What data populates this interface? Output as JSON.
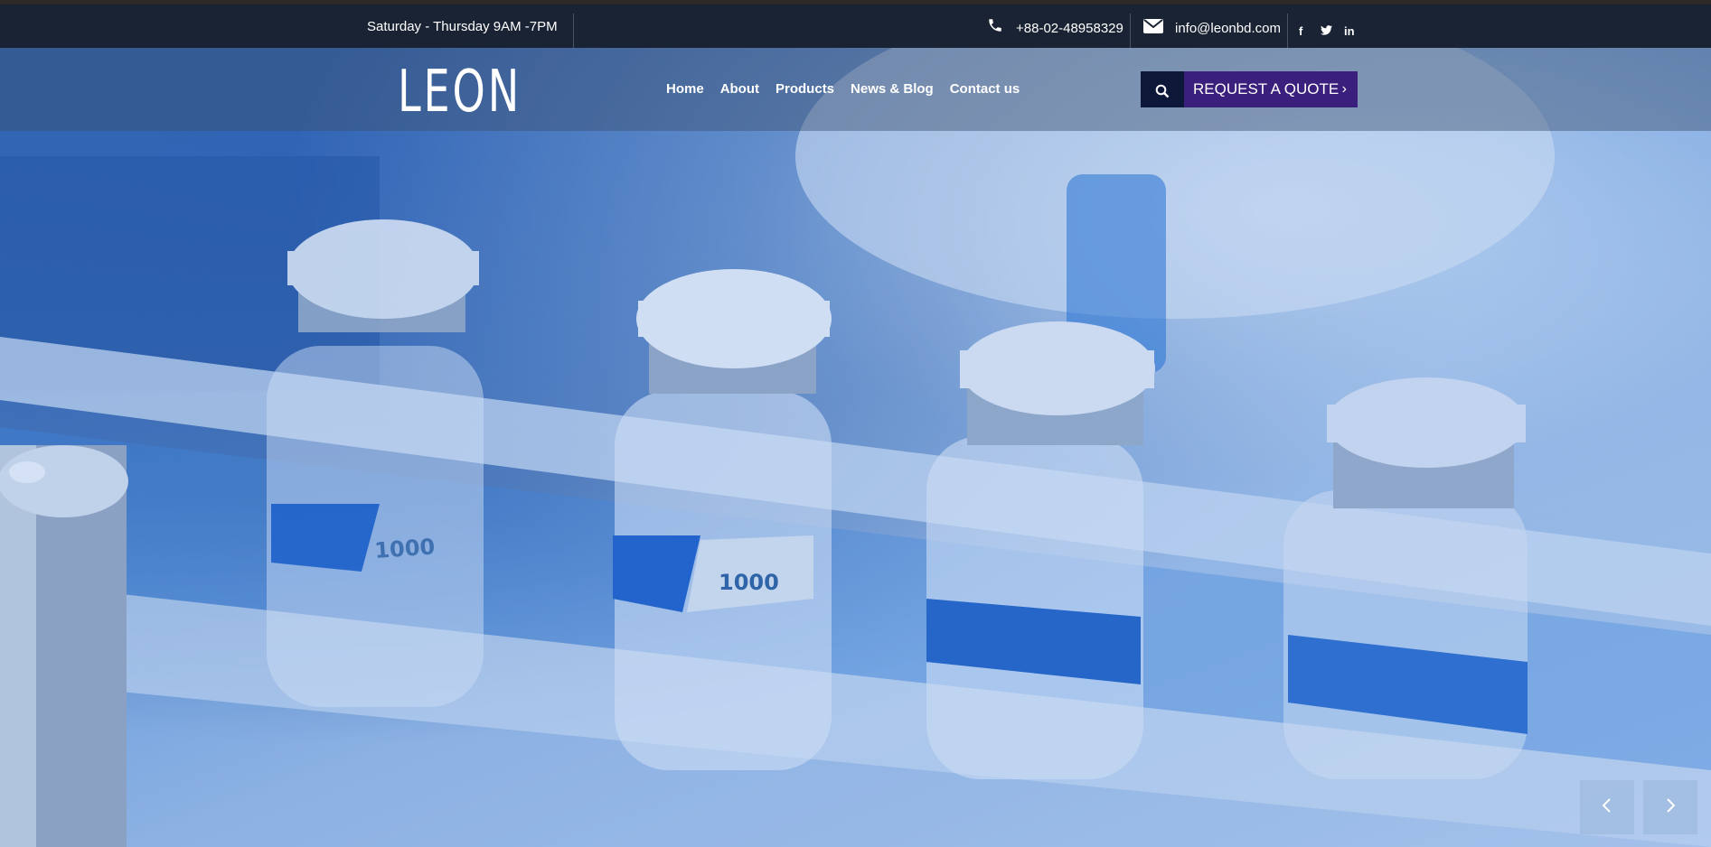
{
  "topbar": {
    "hours": "Saturday - Thursday  9AM -7PM",
    "phone": "+88-02-48958329",
    "email": "info@leonbd.com",
    "social": [
      {
        "icon": "facebook-icon",
        "glyph": "f"
      },
      {
        "icon": "twitter-icon",
        "glyph": "t"
      },
      {
        "icon": "linkedin-icon",
        "glyph": "in"
      }
    ]
  },
  "header": {
    "logo": "LEON",
    "nav": [
      "Home",
      "About",
      "Products",
      "News & Blog",
      "Contact us"
    ],
    "quote_label": "REQUEST A QUOTE",
    "quote_chevron": "›"
  },
  "hero": {
    "vial_label_1": "1000",
    "vial_label_2": "1000"
  },
  "slider": {
    "prev": "‹",
    "next": "›"
  },
  "colors": {
    "topbar": "#1a2333",
    "quote_button": "#3b1f7c",
    "search_button": "#0d1838"
  }
}
